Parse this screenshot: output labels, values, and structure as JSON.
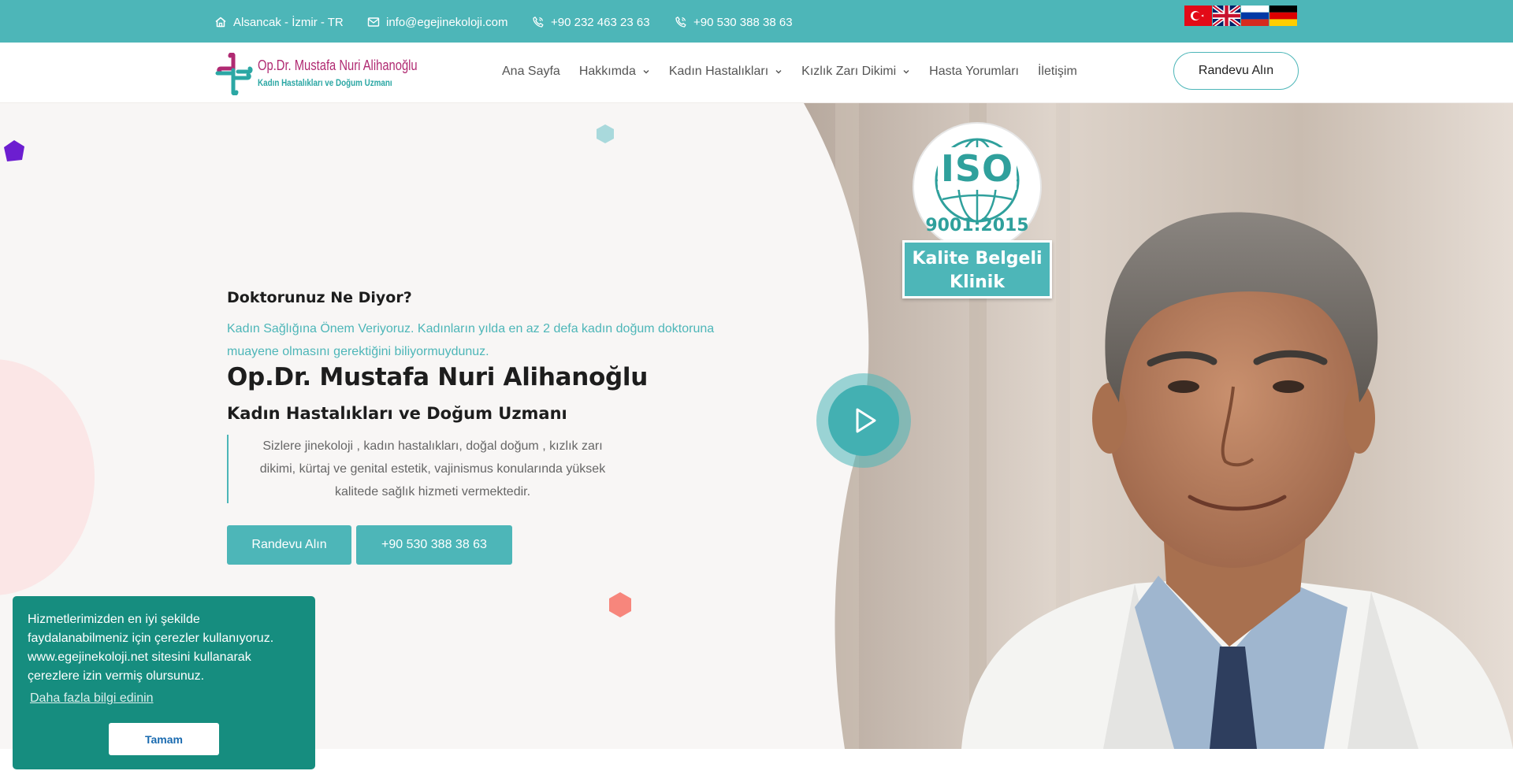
{
  "topbar": {
    "address": "Alsancak - İzmir - TR",
    "email": "info@egejinekoloji.com",
    "phone1": "+90 232 463 23 63",
    "phone2": "+90 530 388 38 63",
    "flags": [
      "turkey-flag",
      "uk-flag",
      "russia-flag",
      "germany-flag"
    ]
  },
  "logo": {
    "name": "Op.Dr. Mustafa Nuri Alihanoğlu",
    "tagline": "Kadın Hastalıkları ve Doğum Uzmanı"
  },
  "nav": {
    "items": [
      {
        "label": "Ana Sayfa",
        "dropdown": false
      },
      {
        "label": "Hakkımda",
        "dropdown": true
      },
      {
        "label": "Kadın Hastalıkları",
        "dropdown": true
      },
      {
        "label": "Kızlık Zarı Dikimi",
        "dropdown": true
      },
      {
        "label": "Hasta Yorumları",
        "dropdown": false
      },
      {
        "label": "İletişim",
        "dropdown": false
      }
    ],
    "cta": "Randevu Alın"
  },
  "hero": {
    "eyebrow": "Doktorunuz Ne Diyor?",
    "subtitle": "Kadın Sağlığına Önem Veriyoruz. Kadınların yılda en az 2 defa kadın doğum doktoruna muayene olmasını gerektiğini biliyormuydunuz.",
    "title": "Op.Dr. Mustafa Nuri Alihanoğlu",
    "title2": "Kadın Hastalıkları ve Doğum Uzmanı",
    "quote": "Sizlere jinekoloji , kadın hastalıkları, doğal doğum , kızlık zarı dikimi, kürtaj ve genital estetik, vajinismus konularında yüksek kalitede sağlık hizmeti vermektedir.",
    "btn_appointment": "Randevu Alın",
    "btn_phone": "+90 530 388 38 63"
  },
  "iso_badge": {
    "big": "ISO",
    "number": "9001:2015",
    "line1": "Kalite Belgeli",
    "line2": "Klinik"
  },
  "cookie": {
    "text": "Hizmetlerimizden en iyi şekilde faydalanabilmeniz için çerezler kullanıyoruz. www.egejinekoloji.net sitesini kullanarak çerezlere izin vermiş olursunuz.",
    "link": "Daha fazla bilgi edinin",
    "ok": "Tamam"
  },
  "colors": {
    "primary": "#4db6b8",
    "cookie_bg": "#168d7f",
    "logo_magenta": "#b02a72",
    "text_dark": "#1d1d1d"
  }
}
